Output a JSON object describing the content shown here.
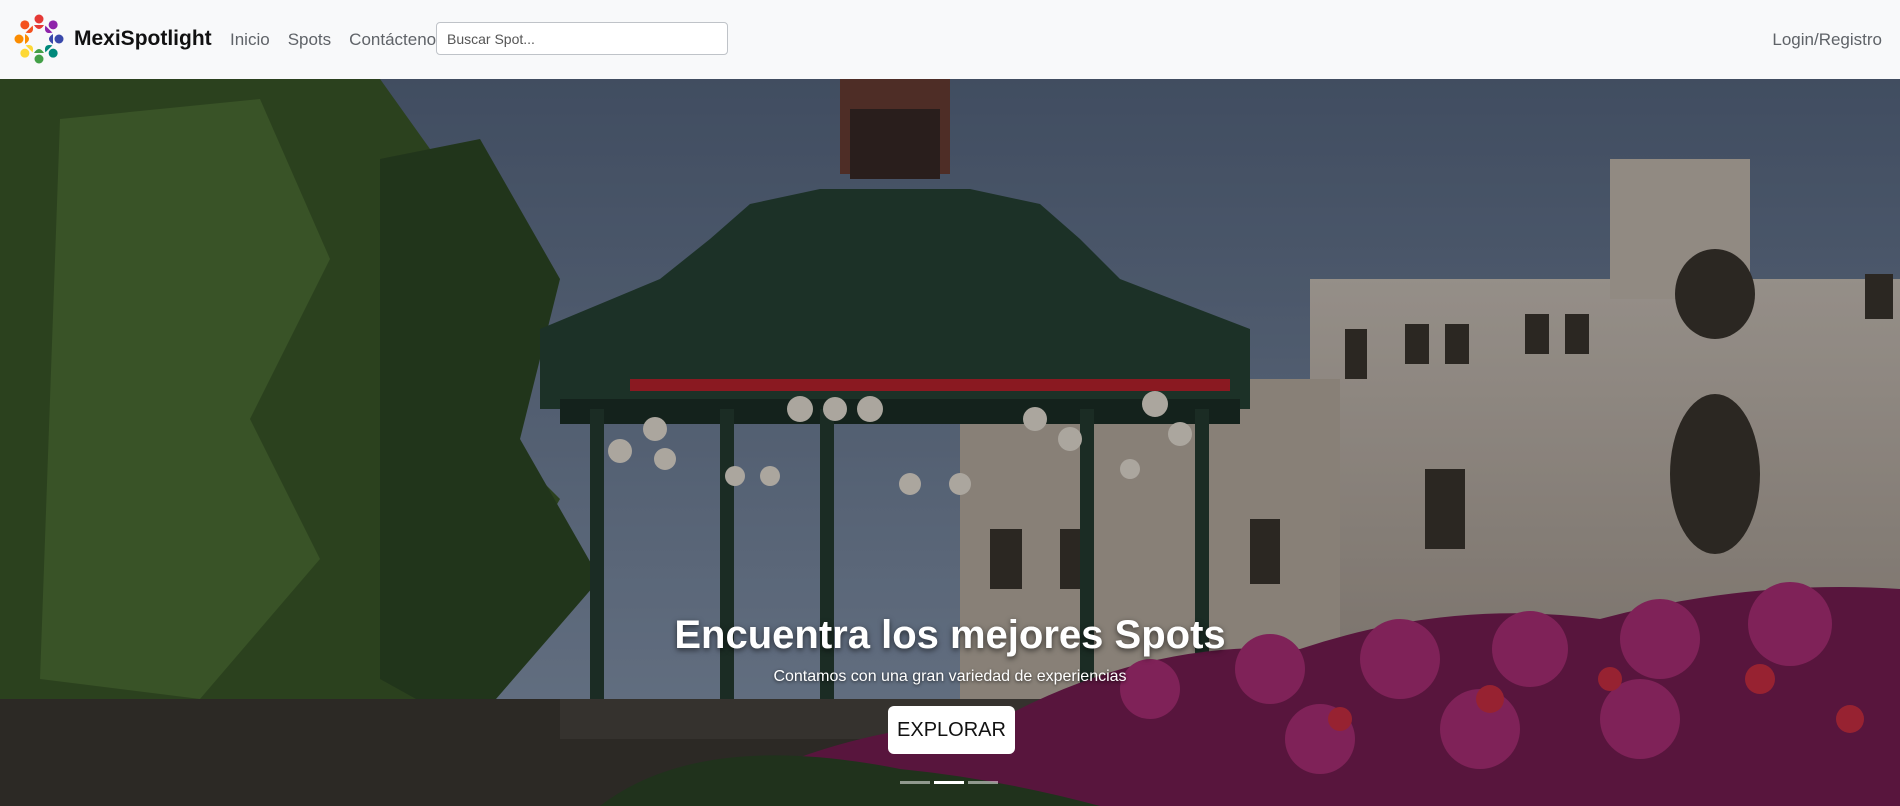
{
  "brand": {
    "name": "MexiSpotlight",
    "logo_icon": "colorful-people-circle-logo"
  },
  "nav": {
    "links": [
      {
        "label": "Inicio"
      },
      {
        "label": "Spots"
      },
      {
        "label": "Contáctenos"
      }
    ],
    "search": {
      "placeholder": "Buscar Spot...",
      "value": ""
    },
    "login_label": "Login/Registro"
  },
  "hero": {
    "title": "Encuentra los mejores Spots",
    "subtitle": "Contamos con una gran variedad de experiencias",
    "button_label": "EXPLORAR",
    "slide_count": 3,
    "active_slide": 2,
    "scene": "kiosk-plaza-photo"
  },
  "colors": {
    "navbar_bg": "#f8f9fa",
    "nav_text": "#5f6368",
    "button_bg": "#ffffff",
    "overlay": "rgba(0,0,0,0.28)"
  }
}
